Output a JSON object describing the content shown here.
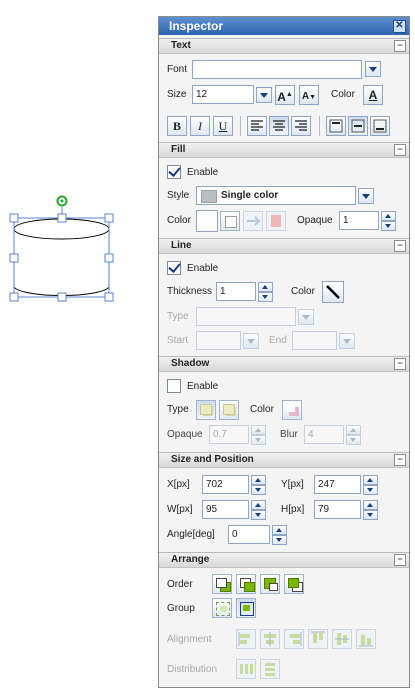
{
  "inspector": {
    "title": "Inspector",
    "close_glyph": "✕",
    "collapse_glyph": "−"
  },
  "text": {
    "section": "Text",
    "font_label": "Font",
    "font_value": "",
    "size_label": "Size",
    "size_value": "12",
    "color_label": "Color",
    "bold": "B",
    "italic": "I",
    "underline": "U"
  },
  "fill": {
    "section": "Fill",
    "enable_label": "Enable",
    "enabled": true,
    "style_label": "Style",
    "style_value": "Single color",
    "color_label": "Color",
    "opaque_label": "Opaque",
    "opaque_value": "1"
  },
  "line": {
    "section": "Line",
    "enable_label": "Enable",
    "enabled": true,
    "thickness_label": "Thickness",
    "thickness_value": "1",
    "color_label": "Color",
    "type_label": "Type",
    "start_label": "Start",
    "end_label": "End"
  },
  "shadow": {
    "section": "Shadow",
    "enable_label": "Enable",
    "enabled": false,
    "type_label": "Type",
    "color_label": "Color",
    "opaque_label": "Opaque",
    "opaque_value": "0.7",
    "blur_label": "Blur",
    "blur_value": "4"
  },
  "size_position": {
    "section": "Size and Position",
    "x_label": "X[px]",
    "x_value": "702",
    "y_label": "Y[px]",
    "y_value": "247",
    "w_label": "W[px]",
    "w_value": "95",
    "h_label": "H[px]",
    "h_value": "79",
    "angle_label": "Angle[deg]",
    "angle_value": "0"
  },
  "arrange": {
    "section": "Arrange",
    "order_label": "Order",
    "group_label": "Group",
    "alignment_label": "Alignment",
    "distribution_label": "Distribution"
  },
  "colors": {
    "accent": "#2d64b0",
    "handle": "#5a86c8",
    "rotate_handle": "#2aa52a",
    "shape_green": "#7ab800"
  }
}
